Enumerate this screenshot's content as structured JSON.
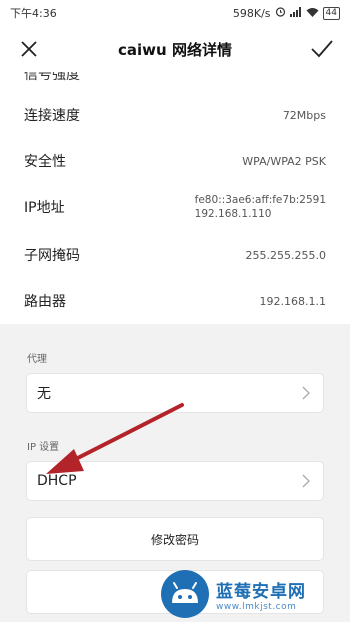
{
  "status_bar": {
    "time": "下午4:36",
    "speed": "598K/s",
    "battery": "44"
  },
  "header": {
    "title": "caiwu  网络详情"
  },
  "details": {
    "cut_label": "信号强度",
    "rows": [
      {
        "label": "连接速度",
        "value": "72Mbps"
      },
      {
        "label": "安全性",
        "value": "WPA/WPA2 PSK"
      },
      {
        "label": "IP地址",
        "value_line1": "fe80::3ae6:aff:fe7b:2591",
        "value_line2": "192.168.1.110"
      },
      {
        "label": "子网掩码",
        "value": "255.255.255.0"
      },
      {
        "label": "路由器",
        "value": "192.168.1.1"
      }
    ]
  },
  "proxy": {
    "section_label": "代理",
    "value": "无"
  },
  "ip_settings": {
    "section_label": "IP 设置",
    "value": "DHCP"
  },
  "actions": {
    "modify_password": "修改密码"
  },
  "watermark": {
    "title": "蓝莓安卓网",
    "url": "www.lmkjst.com"
  },
  "colors": {
    "arrow": "#b3232a",
    "watermark": "#1f6fb5"
  }
}
